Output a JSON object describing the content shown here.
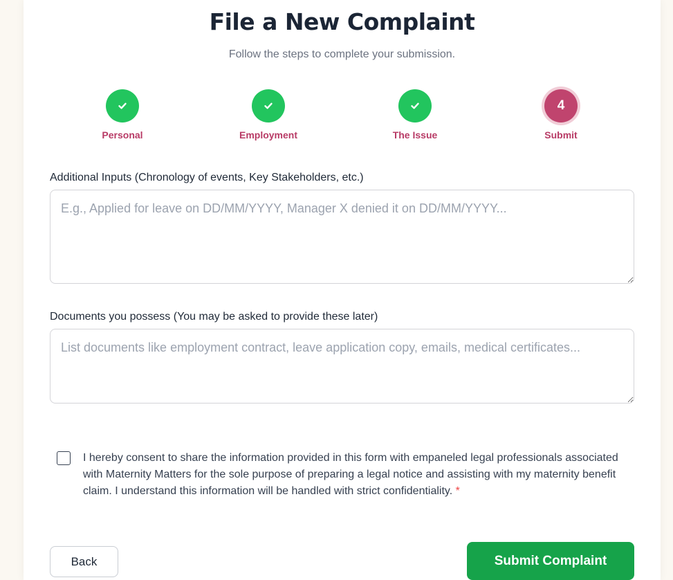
{
  "header": {
    "title": "File a New Complaint",
    "subtitle": "Follow the steps to complete your submission."
  },
  "steps": [
    {
      "label": "Personal",
      "status": "done",
      "icon": "check-icon"
    },
    {
      "label": "Employment",
      "status": "done",
      "icon": "check-icon"
    },
    {
      "label": "The Issue",
      "status": "done",
      "icon": "check-icon"
    },
    {
      "label": "Submit",
      "status": "active",
      "number": "4"
    }
  ],
  "form": {
    "additional_inputs": {
      "label": "Additional Inputs (Chronology of events, Key Stakeholders, etc.)",
      "placeholder": "E.g., Applied for leave on DD/MM/YYYY, Manager X denied it on DD/MM/YYYY...",
      "value": ""
    },
    "documents": {
      "label": "Documents you possess (You may be asked to provide these later)",
      "placeholder": "List documents like employment contract, leave application copy, emails, medical certificates...",
      "value": ""
    },
    "consent": {
      "text": "I hereby consent to share the information provided in this form with empaneled legal professionals associated with Maternity Matters for the sole purpose of preparing a legal notice and assisting with my maternity benefit claim. I understand this information will be handled with strict confidentiality.",
      "required_marker": "*",
      "checked": false
    }
  },
  "actions": {
    "back_label": "Back",
    "submit_label": "Submit Complaint"
  },
  "colors": {
    "done": "#22c55e",
    "active": "#c0446e",
    "step_label": "#b83b66",
    "submit": "#16a34a",
    "title": "#1b2535"
  }
}
